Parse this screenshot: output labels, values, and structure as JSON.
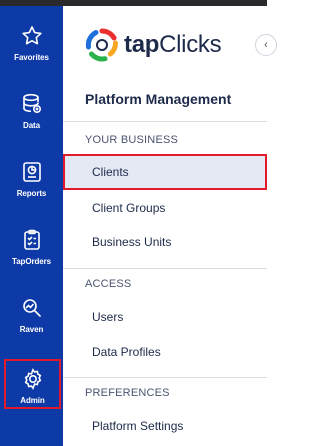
{
  "rail": {
    "items": [
      {
        "label": "Favorites",
        "icon": "star-icon"
      },
      {
        "label": "Data",
        "icon": "database-icon"
      },
      {
        "label": "Reports",
        "icon": "report-icon"
      },
      {
        "label": "TapOrders",
        "icon": "checklist-icon"
      },
      {
        "label": "Raven",
        "icon": "raven-search-icon"
      },
      {
        "label": "Admin",
        "icon": "gear-icon",
        "selected": true
      }
    ]
  },
  "brand": {
    "logo_prefix": "tap",
    "logo_suffix": "Clicks"
  },
  "menu": {
    "title": "Platform Management",
    "sections": [
      {
        "label": "YOUR BUSINESS",
        "items": [
          "Clients",
          "Client Groups",
          "Business Units"
        ]
      },
      {
        "label": "ACCESS",
        "items": [
          "Users",
          "Data Profiles"
        ]
      },
      {
        "label": "PREFERENCES",
        "items": [
          "Platform Settings"
        ]
      }
    ],
    "active_item": "Clients"
  },
  "colors": {
    "rail_bg": "#0d3aa6",
    "highlight": "#e01a2b",
    "active_bg": "#e4e9f4"
  }
}
